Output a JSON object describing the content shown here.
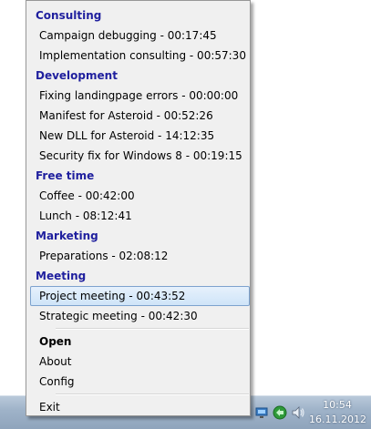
{
  "menu": {
    "groups": [
      {
        "name": "Consulting",
        "items": [
          "Campaign debugging - 00:17:45",
          "Implementation consulting - 00:57:30"
        ]
      },
      {
        "name": "Development",
        "items": [
          "Fixing landingpage errors - 00:00:00",
          "Manifest for Asteroid - 00:52:26",
          "New DLL for Asteroid - 14:12:35",
          "Security fix for Windows 8 - 00:19:15"
        ]
      },
      {
        "name": "Free time",
        "items": [
          "Coffee - 00:42:00",
          "Lunch - 08:12:41"
        ]
      },
      {
        "name": "Marketing",
        "items": [
          "Preparations - 02:08:12"
        ]
      },
      {
        "name": "Meeting",
        "items": [
          "Project meeting - 00:43:52",
          "Strategic meeting - 00:42:30"
        ]
      }
    ],
    "highlighted_item": "Project meeting - 00:43:52",
    "actions": {
      "open": "Open",
      "about": "About",
      "config": "Config",
      "exit": "Exit"
    }
  },
  "taskbar": {
    "time": "10:54",
    "date": "16.11.2012",
    "tray_icons": [
      "network-icon",
      "sync-icon",
      "volume-icon"
    ]
  },
  "colors": {
    "group_header": "#1f1f9e",
    "highlight_border": "#7da2ce",
    "menu_background": "#f0f0f0"
  }
}
